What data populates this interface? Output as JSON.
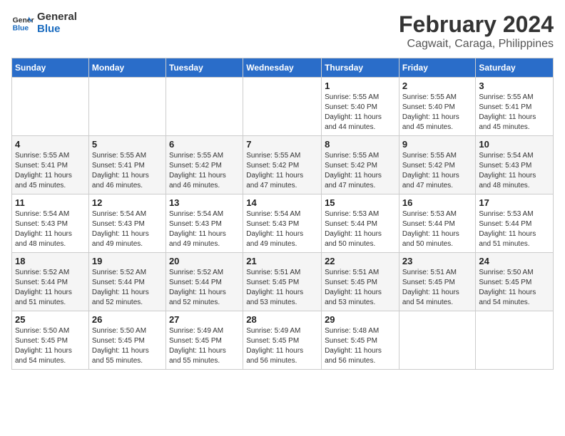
{
  "header": {
    "logo_line1": "General",
    "logo_line2": "Blue",
    "month": "February 2024",
    "location": "Cagwait, Caraga, Philippines"
  },
  "weekdays": [
    "Sunday",
    "Monday",
    "Tuesday",
    "Wednesday",
    "Thursday",
    "Friday",
    "Saturday"
  ],
  "weeks": [
    [
      {
        "day": "",
        "info": ""
      },
      {
        "day": "",
        "info": ""
      },
      {
        "day": "",
        "info": ""
      },
      {
        "day": "",
        "info": ""
      },
      {
        "day": "1",
        "info": "Sunrise: 5:55 AM\nSunset: 5:40 PM\nDaylight: 11 hours\nand 44 minutes."
      },
      {
        "day": "2",
        "info": "Sunrise: 5:55 AM\nSunset: 5:40 PM\nDaylight: 11 hours\nand 45 minutes."
      },
      {
        "day": "3",
        "info": "Sunrise: 5:55 AM\nSunset: 5:41 PM\nDaylight: 11 hours\nand 45 minutes."
      }
    ],
    [
      {
        "day": "4",
        "info": "Sunrise: 5:55 AM\nSunset: 5:41 PM\nDaylight: 11 hours\nand 45 minutes."
      },
      {
        "day": "5",
        "info": "Sunrise: 5:55 AM\nSunset: 5:41 PM\nDaylight: 11 hours\nand 46 minutes."
      },
      {
        "day": "6",
        "info": "Sunrise: 5:55 AM\nSunset: 5:42 PM\nDaylight: 11 hours\nand 46 minutes."
      },
      {
        "day": "7",
        "info": "Sunrise: 5:55 AM\nSunset: 5:42 PM\nDaylight: 11 hours\nand 47 minutes."
      },
      {
        "day": "8",
        "info": "Sunrise: 5:55 AM\nSunset: 5:42 PM\nDaylight: 11 hours\nand 47 minutes."
      },
      {
        "day": "9",
        "info": "Sunrise: 5:55 AM\nSunset: 5:42 PM\nDaylight: 11 hours\nand 47 minutes."
      },
      {
        "day": "10",
        "info": "Sunrise: 5:54 AM\nSunset: 5:43 PM\nDaylight: 11 hours\nand 48 minutes."
      }
    ],
    [
      {
        "day": "11",
        "info": "Sunrise: 5:54 AM\nSunset: 5:43 PM\nDaylight: 11 hours\nand 48 minutes."
      },
      {
        "day": "12",
        "info": "Sunrise: 5:54 AM\nSunset: 5:43 PM\nDaylight: 11 hours\nand 49 minutes."
      },
      {
        "day": "13",
        "info": "Sunrise: 5:54 AM\nSunset: 5:43 PM\nDaylight: 11 hours\nand 49 minutes."
      },
      {
        "day": "14",
        "info": "Sunrise: 5:54 AM\nSunset: 5:43 PM\nDaylight: 11 hours\nand 49 minutes."
      },
      {
        "day": "15",
        "info": "Sunrise: 5:53 AM\nSunset: 5:44 PM\nDaylight: 11 hours\nand 50 minutes."
      },
      {
        "day": "16",
        "info": "Sunrise: 5:53 AM\nSunset: 5:44 PM\nDaylight: 11 hours\nand 50 minutes."
      },
      {
        "day": "17",
        "info": "Sunrise: 5:53 AM\nSunset: 5:44 PM\nDaylight: 11 hours\nand 51 minutes."
      }
    ],
    [
      {
        "day": "18",
        "info": "Sunrise: 5:52 AM\nSunset: 5:44 PM\nDaylight: 11 hours\nand 51 minutes."
      },
      {
        "day": "19",
        "info": "Sunrise: 5:52 AM\nSunset: 5:44 PM\nDaylight: 11 hours\nand 52 minutes."
      },
      {
        "day": "20",
        "info": "Sunrise: 5:52 AM\nSunset: 5:44 PM\nDaylight: 11 hours\nand 52 minutes."
      },
      {
        "day": "21",
        "info": "Sunrise: 5:51 AM\nSunset: 5:45 PM\nDaylight: 11 hours\nand 53 minutes."
      },
      {
        "day": "22",
        "info": "Sunrise: 5:51 AM\nSunset: 5:45 PM\nDaylight: 11 hours\nand 53 minutes."
      },
      {
        "day": "23",
        "info": "Sunrise: 5:51 AM\nSunset: 5:45 PM\nDaylight: 11 hours\nand 54 minutes."
      },
      {
        "day": "24",
        "info": "Sunrise: 5:50 AM\nSunset: 5:45 PM\nDaylight: 11 hours\nand 54 minutes."
      }
    ],
    [
      {
        "day": "25",
        "info": "Sunrise: 5:50 AM\nSunset: 5:45 PM\nDaylight: 11 hours\nand 54 minutes."
      },
      {
        "day": "26",
        "info": "Sunrise: 5:50 AM\nSunset: 5:45 PM\nDaylight: 11 hours\nand 55 minutes."
      },
      {
        "day": "27",
        "info": "Sunrise: 5:49 AM\nSunset: 5:45 PM\nDaylight: 11 hours\nand 55 minutes."
      },
      {
        "day": "28",
        "info": "Sunrise: 5:49 AM\nSunset: 5:45 PM\nDaylight: 11 hours\nand 56 minutes."
      },
      {
        "day": "29",
        "info": "Sunrise: 5:48 AM\nSunset: 5:45 PM\nDaylight: 11 hours\nand 56 minutes."
      },
      {
        "day": "",
        "info": ""
      },
      {
        "day": "",
        "info": ""
      }
    ]
  ]
}
